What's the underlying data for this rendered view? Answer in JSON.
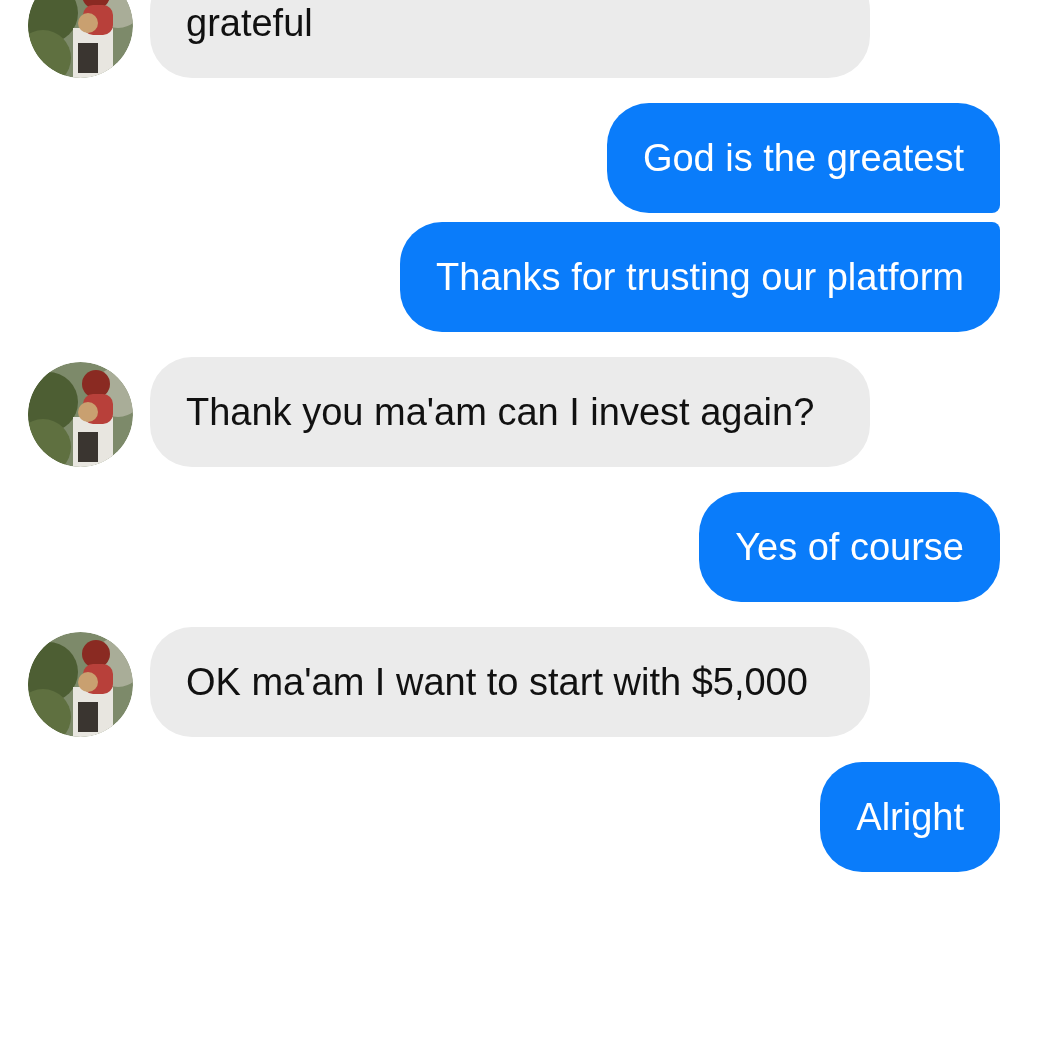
{
  "messages": [
    {
      "kind": "incoming",
      "text": "grateful"
    },
    {
      "kind": "outgoing",
      "text": "God is the greatest"
    },
    {
      "kind": "outgoing",
      "text": "Thanks for trusting our platform"
    },
    {
      "kind": "incoming",
      "text": "Thank you ma'am can I invest again?"
    },
    {
      "kind": "outgoing",
      "text": "Yes of course"
    },
    {
      "kind": "incoming",
      "text": "OK ma'am I want to start with $5,000"
    },
    {
      "kind": "outgoing",
      "text": "Alright"
    }
  ]
}
